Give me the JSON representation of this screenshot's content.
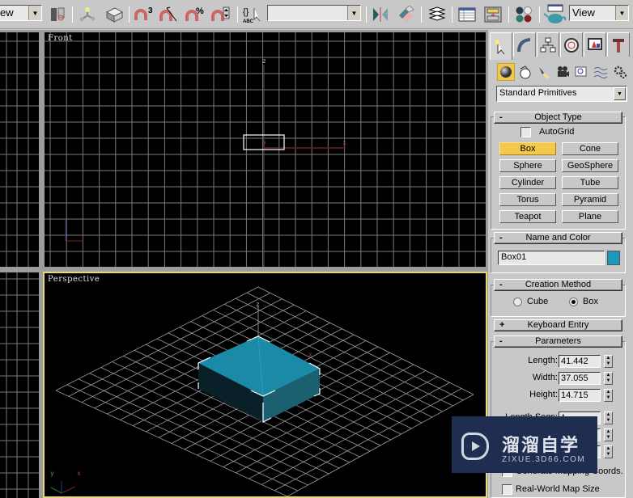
{
  "toolbar": {
    "left_combo_value": "ew",
    "center_combo_value": "",
    "right_combo_value": "View",
    "icons": [
      "align-icon",
      "select-and-link-icon",
      "bind-space-warp-icon",
      "snaps-toggle-icon",
      "angle-snap-icon",
      "percent-snap-icon",
      "spinner-snap-icon",
      "edit-named-selections-icon",
      "mirror-icon",
      "align-tool-icon",
      "layer-manager-icon",
      "curve-editor-icon",
      "schematic-view-icon",
      "material-editor-icon",
      "render-scene-icon"
    ]
  },
  "viewports": {
    "front": {
      "label": "Front",
      "axis_x": "x",
      "axis_y": "y",
      "axis_z": "z"
    },
    "perspective": {
      "label": "Perspective",
      "axis_x": "x",
      "axis_y": "y",
      "axis_z": "z"
    }
  },
  "command_panel": {
    "tabs": [
      "create-tab",
      "modify-tab",
      "hierarchy-tab",
      "motion-tab",
      "display-tab",
      "utilities-tab"
    ],
    "categories": [
      "geometry-icon",
      "shapes-icon",
      "lights-icon",
      "cameras-icon",
      "helpers-icon",
      "space-warps-icon",
      "systems-icon"
    ],
    "dropdown_value": "Standard Primitives",
    "object_type": {
      "title": "Object Type",
      "sign": "-",
      "autogrid_label": "AutoGrid",
      "buttons": [
        "Box",
        "Cone",
        "Sphere",
        "GeoSphere",
        "Cylinder",
        "Tube",
        "Torus",
        "Pyramid",
        "Teapot",
        "Plane"
      ],
      "active": "Box"
    },
    "name_and_color": {
      "title": "Name and Color",
      "sign": "-",
      "name_value": "Box01",
      "color": "#1a9ab8"
    },
    "creation_method": {
      "title": "Creation Method",
      "sign": "-",
      "options": [
        "Cube",
        "Box"
      ],
      "selected": "Box"
    },
    "keyboard_entry": {
      "title": "Keyboard Entry",
      "sign": "+"
    },
    "parameters": {
      "title": "Parameters",
      "sign": "-",
      "length_label": "Length:",
      "length_value": "41.442",
      "width_label": "Width:",
      "width_value": "37.055",
      "height_label": "Height:",
      "height_value": "14.715",
      "length_segs_label": "Length Segs:",
      "length_segs_value": "1",
      "gen_coords_label": "Generate Mapping Coords.",
      "real_world_label": "Real-World Map Size"
    }
  },
  "watermark": {
    "title": "溜溜自学",
    "subtitle": "ZIXUE.3D66.COM"
  }
}
